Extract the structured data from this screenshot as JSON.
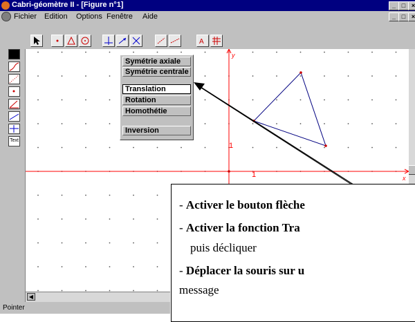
{
  "window": {
    "title": "Cabri-géomètre II - [Figure n°1]",
    "controls": [
      "_",
      "□",
      "×"
    ]
  },
  "menubar": {
    "items": [
      "Fichier",
      "Edition",
      "Options",
      "Fenêtre",
      "Aide"
    ],
    "mdi_controls": [
      "_",
      "□",
      "×"
    ]
  },
  "toolbar": {
    "tools": [
      "pointer-tool",
      "point-tool",
      "polygon-tool",
      "circle-tool",
      "perpendicular-tool",
      "transformation-tool",
      "check-property-tool",
      "measure-tool",
      "display-tool",
      "label-tool",
      "grid-tool"
    ]
  },
  "dropdown": {
    "items": [
      {
        "label": "Symétrie axiale",
        "selected": false
      },
      {
        "label": "Symétrie centrale",
        "selected": false
      },
      {
        "label": "Translation",
        "selected": true
      },
      {
        "label": "Rotation",
        "selected": false
      },
      {
        "label": "Homothétie",
        "selected": false
      },
      {
        "label": "Inversion",
        "selected": false
      }
    ]
  },
  "axes": {
    "x_label": "x",
    "y_label": "y",
    "tick_x": "1",
    "tick_y": "1"
  },
  "leftbar": {
    "text_button": "Text"
  },
  "statusbar": {
    "text": "Pointer"
  },
  "instructions": {
    "line1_prefix": "- ",
    "line1": "Activer le bouton flèche",
    "line2_prefix": "- ",
    "line2": "Activer la fonction Tra",
    "line3": "puis décliquer",
    "line4_prefix": "- ",
    "line4": "Déplacer la souris sur u",
    "line5": "message"
  },
  "colors": {
    "titlebar": "#000080",
    "axes": "#ff0000",
    "triangle": "#000080",
    "vertex": "#cc0000"
  }
}
